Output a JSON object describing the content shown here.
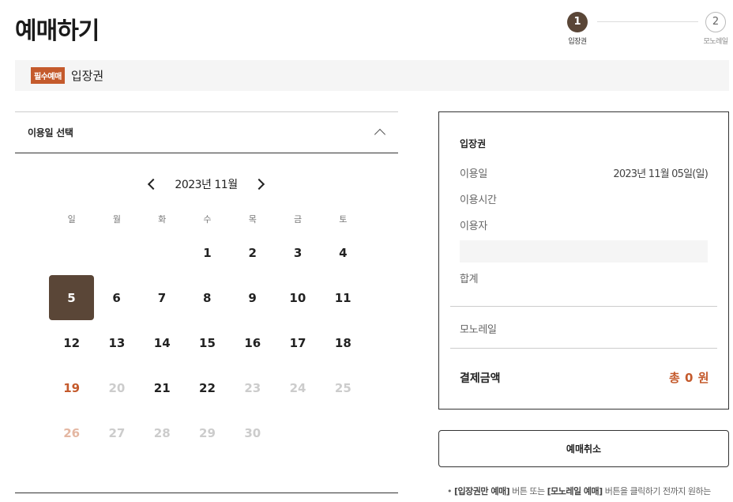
{
  "page_title": "예매하기",
  "steps": [
    {
      "number": "1",
      "label": "입장권",
      "active": true
    },
    {
      "number": "2",
      "label": "모노레일",
      "active": false
    }
  ],
  "section": {
    "badge": "필수예매",
    "title": "입장권"
  },
  "date_select": {
    "label": "이용일 선택"
  },
  "calendar": {
    "month_label": "2023년 11월",
    "weekdays": [
      "일",
      "월",
      "화",
      "수",
      "목",
      "금",
      "토"
    ],
    "selected_day": "5",
    "weeks": [
      [
        {
          "d": "",
          "s": "empty"
        },
        {
          "d": "",
          "s": "empty"
        },
        {
          "d": "",
          "s": "empty"
        },
        {
          "d": "1",
          "s": "normal"
        },
        {
          "d": "2",
          "s": "normal"
        },
        {
          "d": "3",
          "s": "normal"
        },
        {
          "d": "4",
          "s": "normal"
        }
      ],
      [
        {
          "d": "5",
          "s": "selected"
        },
        {
          "d": "6",
          "s": "normal"
        },
        {
          "d": "7",
          "s": "normal"
        },
        {
          "d": "8",
          "s": "normal"
        },
        {
          "d": "9",
          "s": "normal"
        },
        {
          "d": "10",
          "s": "normal"
        },
        {
          "d": "11",
          "s": "normal"
        }
      ],
      [
        {
          "d": "12",
          "s": "normal"
        },
        {
          "d": "13",
          "s": "normal"
        },
        {
          "d": "14",
          "s": "normal"
        },
        {
          "d": "15",
          "s": "normal"
        },
        {
          "d": "16",
          "s": "normal"
        },
        {
          "d": "17",
          "s": "normal"
        },
        {
          "d": "18",
          "s": "normal"
        }
      ],
      [
        {
          "d": "19",
          "s": "sun"
        },
        {
          "d": "20",
          "s": "disabled"
        },
        {
          "d": "21",
          "s": "normal"
        },
        {
          "d": "22",
          "s": "normal"
        },
        {
          "d": "23",
          "s": "disabled"
        },
        {
          "d": "24",
          "s": "disabled"
        },
        {
          "d": "25",
          "s": "disabled"
        }
      ],
      [
        {
          "d": "26",
          "s": "sun-disabled"
        },
        {
          "d": "27",
          "s": "disabled"
        },
        {
          "d": "28",
          "s": "disabled"
        },
        {
          "d": "29",
          "s": "disabled"
        },
        {
          "d": "30",
          "s": "disabled"
        },
        {
          "d": "",
          "s": "empty"
        },
        {
          "d": "",
          "s": "empty"
        }
      ]
    ]
  },
  "summary": {
    "title": "입장권",
    "date_label": "이용일",
    "date_value": "2023년 11월 05일(일)",
    "time_label": "이용시간",
    "user_label": "이용자",
    "subtotal_label": "합계",
    "monorail_label": "모노레일",
    "payment_label": "결제금액",
    "payment_value": "총 0 원"
  },
  "cancel_button": "예매취소",
  "note": {
    "bullet": "•",
    "part1": "[입장권만 예매]",
    "part2": " 버튼 또는 ",
    "part3": "[모노레일 예매]",
    "part4": " 버튼을 클릭하기 전까지 원하는"
  },
  "colors": {
    "accent": "#c45a2c",
    "selected": "#5a4637"
  }
}
